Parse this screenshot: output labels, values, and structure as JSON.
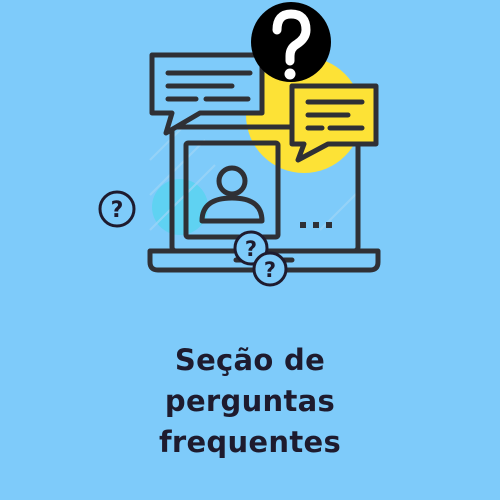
{
  "heading": {
    "lines": [
      "Seção de",
      "perguntas",
      "frequentes"
    ]
  },
  "illustration": {
    "question_mark": "?",
    "typing_dots": "...",
    "colors": {
      "background": "#7ecbfa",
      "outline": "#2f3035",
      "accent_yellow": "#fde236",
      "accent_cyan": "#59d4f0",
      "badge_fill": "#000000",
      "badge_text": "#ffffff"
    },
    "icons": [
      "laptop-icon",
      "user-profile-icon",
      "chat-bubble-icon",
      "question-badge-icon",
      "question-circle-icon"
    ]
  }
}
